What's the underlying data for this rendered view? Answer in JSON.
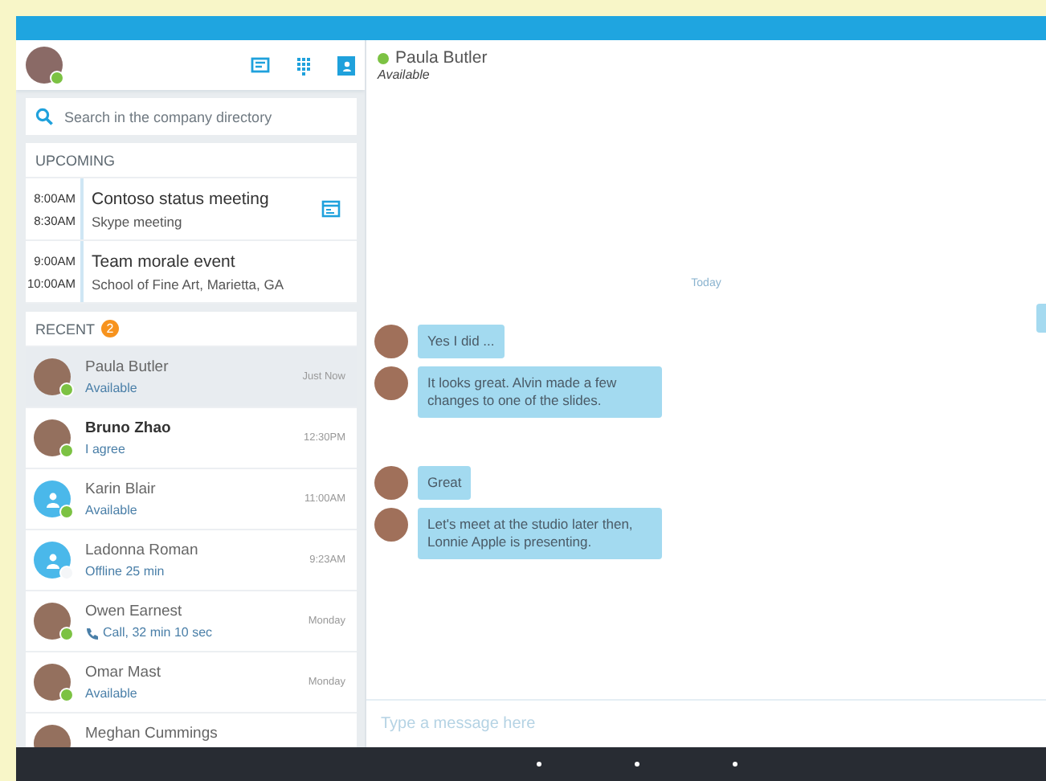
{
  "sidebar": {
    "search": {
      "placeholder": "Search in the company directory"
    },
    "upcoming": {
      "title": "UPCOMING",
      "events": [
        {
          "start": "8:00AM",
          "end": "8:30AM",
          "title": "Contoso status meeting",
          "subtitle": "Skype meeting",
          "online": true
        },
        {
          "start": "9:00AM",
          "end": "10:00AM",
          "title": "Team morale event",
          "subtitle": "School of Fine Art, Marietta, GA",
          "online": false
        }
      ]
    },
    "recent": {
      "title": "RECENT",
      "badge": "2",
      "items": [
        {
          "name": "Paula Butler",
          "status": "Available",
          "time": "Just Now",
          "kind": "photo",
          "color": "#7cc243",
          "unread": false,
          "call": false,
          "selected": true
        },
        {
          "name": "Bruno Zhao",
          "status": "I agree",
          "time": "12:30PM",
          "kind": "photo",
          "color": "#7cc243",
          "unread": true,
          "call": false,
          "selected": false
        },
        {
          "name": "Karin Blair",
          "status": "Available",
          "time": "11:00AM",
          "kind": "default",
          "color": "#7cc243",
          "unread": false,
          "call": false,
          "selected": false
        },
        {
          "name": "Ladonna Roman",
          "status": "Offline 25 min",
          "time": "9:23AM",
          "kind": "default",
          "color": "#f4f6f8",
          "unread": false,
          "call": false,
          "selected": false
        },
        {
          "name": "Owen Earnest",
          "status": "Call, 32 min 10 sec",
          "time": "Monday",
          "kind": "photo",
          "color": "#7cc243",
          "unread": false,
          "call": true,
          "selected": false
        },
        {
          "name": "Omar Mast",
          "status": "Available",
          "time": "Monday",
          "kind": "photo",
          "color": "#7cc243",
          "unread": false,
          "call": false,
          "selected": false
        },
        {
          "name": "Meghan Cummings",
          "kind": "photo",
          "unread": false,
          "selected": false
        }
      ]
    }
  },
  "chat": {
    "contact": {
      "name": "Paula Butler",
      "status": "Available",
      "color": "#7cc243"
    },
    "date_label": "Today",
    "message_groups": [
      {
        "messages": [
          "Yes I did ...",
          "It looks great. Alvin made a few changes to one of the slides."
        ]
      },
      {
        "messages": [
          "Great",
          "Let's meet at the studio later then, Lonnie Apple is presenting."
        ]
      }
    ],
    "input": {
      "placeholder": "Type a message here"
    }
  }
}
